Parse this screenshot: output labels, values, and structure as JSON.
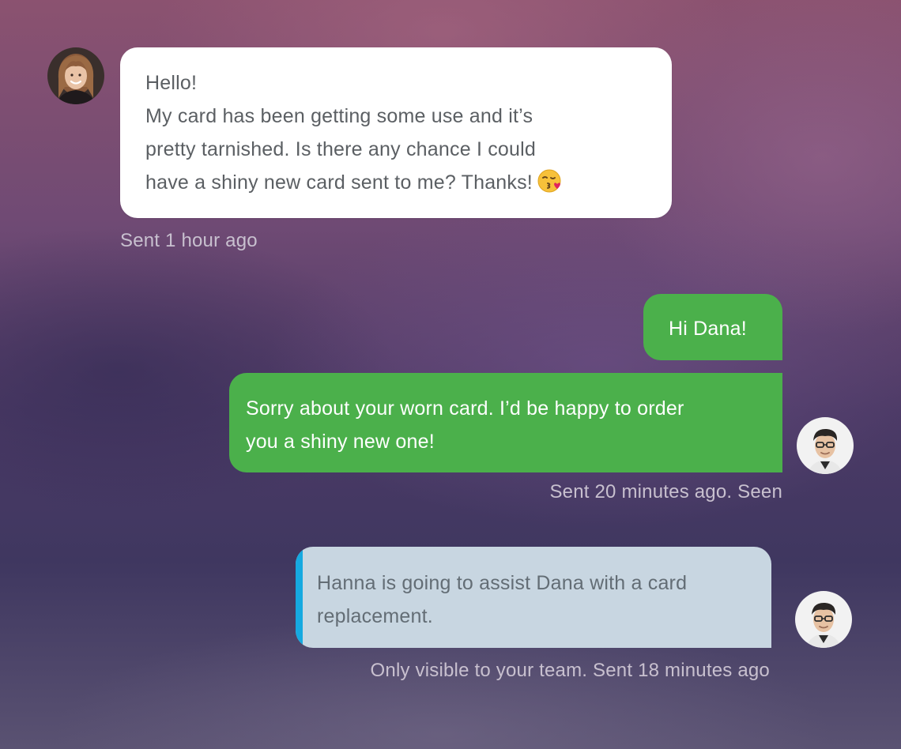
{
  "conversation": {
    "incoming": {
      "lines": [
        "Hello!",
        "My card has been getting some use and it’s",
        "pretty tarnished. Is there any chance I could",
        "have a shiny new card sent to me? Thanks!"
      ],
      "emoji": "kissing-face-with-heart-emoji",
      "meta": "Sent 1 hour ago"
    },
    "outgoing_first": {
      "text": "Hi Dana!"
    },
    "outgoing_second": {
      "lines": [
        "Sorry about your worn card. I’d be happy to order",
        "you a shiny new one!"
      ],
      "meta": "Sent 20 minutes ago. Seen"
    },
    "internal_note": {
      "lines": [
        "Hanna is going to assist Dana with a card",
        "replacement."
      ],
      "meta": "Only visible to your team. Sent 18 minutes ago"
    }
  },
  "colors": {
    "outgoing_bubble": "#4bb04b",
    "incoming_bubble": "#ffffff",
    "note_bubble": "#c8d6e1",
    "note_accent": "#16a9e0"
  },
  "avatars": {
    "customer": "customer-avatar-woman",
    "agent": "agent-avatar-man-glasses"
  }
}
